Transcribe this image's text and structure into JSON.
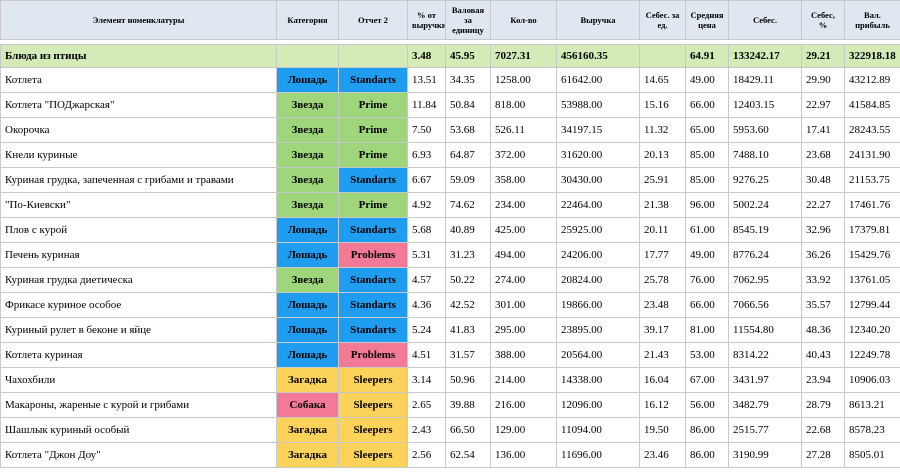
{
  "headers": {
    "name": "Элемент номенклатуры",
    "category": "Категория",
    "report2": "Отчет 2",
    "pct": "% от выручки",
    "gross_unit": "Валовая за единицу",
    "qty": "Кол-во",
    "revenue": "Выручка",
    "cost_unit": "Себес. за ед.",
    "avg_price": "Средняя цена",
    "cost": "Себес.",
    "cost_pct": "Себес, %",
    "gross_profit": "Вал. прибыль"
  },
  "total": {
    "name": "Блюда из птицы",
    "category": "",
    "report2": "",
    "pct": "3.48",
    "gross_unit": "45.95",
    "qty": "7027.31",
    "revenue": "456160.35",
    "cost_unit": "",
    "avg_price": "64.91",
    "cost": "133242.17",
    "cost_pct": "29.21",
    "gross_profit": "322918.18"
  },
  "rows": [
    {
      "name": "Котлета",
      "category": "Лошадь",
      "cat_class": "c-loshad",
      "report2": "Standarts",
      "rep_class": "r-standarts",
      "pct": "13.51",
      "gross_unit": "34.35",
      "qty": "1258.00",
      "revenue": "61642.00",
      "cost_unit": "14.65",
      "avg_price": "49.00",
      "cost": "18429.11",
      "cost_pct": "29.90",
      "gross_profit": "43212.89"
    },
    {
      "name": "Котлета \"ПОДжарская\"",
      "category": "Звезда",
      "cat_class": "c-zvezda",
      "report2": "Prime",
      "rep_class": "r-prime",
      "pct": "11.84",
      "gross_unit": "50.84",
      "qty": "818.00",
      "revenue": "53988.00",
      "cost_unit": "15.16",
      "avg_price": "66.00",
      "cost": "12403.15",
      "cost_pct": "22.97",
      "gross_profit": "41584.85"
    },
    {
      "name": "Окорочка",
      "category": "Звезда",
      "cat_class": "c-zvezda",
      "report2": "Prime",
      "rep_class": "r-prime",
      "pct": "7.50",
      "gross_unit": "53.68",
      "qty": "526.11",
      "revenue": "34197.15",
      "cost_unit": "11.32",
      "avg_price": "65.00",
      "cost": "5953.60",
      "cost_pct": "17.41",
      "gross_profit": "28243.55"
    },
    {
      "name": "Кнели куриные",
      "category": "Звезда",
      "cat_class": "c-zvezda",
      "report2": "Prime",
      "rep_class": "r-prime",
      "pct": "6.93",
      "gross_unit": "64.87",
      "qty": "372.00",
      "revenue": "31620.00",
      "cost_unit": "20.13",
      "avg_price": "85.00",
      "cost": "7488.10",
      "cost_pct": "23.68",
      "gross_profit": "24131.90"
    },
    {
      "name": "Куриная грудка, запеченная с грибами и травами",
      "category": "Звезда",
      "cat_class": "c-zvezda",
      "report2": "Standarts",
      "rep_class": "r-standarts",
      "pct": "6.67",
      "gross_unit": "59.09",
      "qty": "358.00",
      "revenue": "30430.00",
      "cost_unit": "25.91",
      "avg_price": "85.00",
      "cost": "9276.25",
      "cost_pct": "30.48",
      "gross_profit": "21153.75"
    },
    {
      "name": "\"По-Киевски\"",
      "category": "Звезда",
      "cat_class": "c-zvezda",
      "report2": "Prime",
      "rep_class": "r-prime",
      "pct": "4.92",
      "gross_unit": "74.62",
      "qty": "234.00",
      "revenue": "22464.00",
      "cost_unit": "21.38",
      "avg_price": "96.00",
      "cost": "5002.24",
      "cost_pct": "22.27",
      "gross_profit": "17461.76"
    },
    {
      "name": "Плов с курой",
      "category": "Лошадь",
      "cat_class": "c-loshad",
      "report2": "Standarts",
      "rep_class": "r-standarts",
      "pct": "5.68",
      "gross_unit": "40.89",
      "qty": "425.00",
      "revenue": "25925.00",
      "cost_unit": "20.11",
      "avg_price": "61.00",
      "cost": "8545.19",
      "cost_pct": "32.96",
      "gross_profit": "17379.81"
    },
    {
      "name": "Печень куриная",
      "category": "Лошадь",
      "cat_class": "c-loshad",
      "report2": "Problems",
      "rep_class": "r-problems",
      "pct": "5.31",
      "gross_unit": "31.23",
      "qty": "494.00",
      "revenue": "24206.00",
      "cost_unit": "17.77",
      "avg_price": "49.00",
      "cost": "8776.24",
      "cost_pct": "36.26",
      "gross_profit": "15429.76"
    },
    {
      "name": "Куриная грудка диетическа",
      "category": "Звезда",
      "cat_class": "c-zvezda",
      "report2": "Standarts",
      "rep_class": "r-standarts",
      "pct": "4.57",
      "gross_unit": "50.22",
      "qty": "274.00",
      "revenue": "20824.00",
      "cost_unit": "25.78",
      "avg_price": "76.00",
      "cost": "7062.95",
      "cost_pct": "33.92",
      "gross_profit": "13761.05"
    },
    {
      "name": "Фрикасе куриное особое",
      "category": "Лошадь",
      "cat_class": "c-loshad",
      "report2": "Standarts",
      "rep_class": "r-standarts",
      "pct": "4.36",
      "gross_unit": "42.52",
      "qty": "301.00",
      "revenue": "19866.00",
      "cost_unit": "23.48",
      "avg_price": "66.00",
      "cost": "7066.56",
      "cost_pct": "35.57",
      "gross_profit": "12799.44"
    },
    {
      "name": "Куриный рулет в беконе и яйце",
      "category": "Лошадь",
      "cat_class": "c-loshad",
      "report2": "Standarts",
      "rep_class": "r-standarts",
      "pct": "5.24",
      "gross_unit": "41.83",
      "qty": "295.00",
      "revenue": "23895.00",
      "cost_unit": "39.17",
      "avg_price": "81.00",
      "cost": "11554.80",
      "cost_pct": "48.36",
      "gross_profit": "12340.20"
    },
    {
      "name": "Котлета куриная",
      "category": "Лошадь",
      "cat_class": "c-loshad",
      "report2": "Problems",
      "rep_class": "r-problems",
      "pct": "4.51",
      "gross_unit": "31.57",
      "qty": "388.00",
      "revenue": "20564.00",
      "cost_unit": "21.43",
      "avg_price": "53.00",
      "cost": "8314.22",
      "cost_pct": "40.43",
      "gross_profit": "12249.78"
    },
    {
      "name": "Чахохбили",
      "category": "Загадка",
      "cat_class": "c-zagadka",
      "report2": "Sleepers",
      "rep_class": "r-sleepers",
      "pct": "3.14",
      "gross_unit": "50.96",
      "qty": "214.00",
      "revenue": "14338.00",
      "cost_unit": "16.04",
      "avg_price": "67.00",
      "cost": "3431.97",
      "cost_pct": "23.94",
      "gross_profit": "10906.03"
    },
    {
      "name": "Макароны, жареные с курой и грибами",
      "category": "Собака",
      "cat_class": "c-sobaka",
      "report2": "Sleepers",
      "rep_class": "r-sleepers",
      "pct": "2.65",
      "gross_unit": "39.88",
      "qty": "216.00",
      "revenue": "12096.00",
      "cost_unit": "16.12",
      "avg_price": "56.00",
      "cost": "3482.79",
      "cost_pct": "28.79",
      "gross_profit": "8613.21"
    },
    {
      "name": "Шашлык куриный особый",
      "category": "Загадка",
      "cat_class": "c-zagadka",
      "report2": "Sleepers",
      "rep_class": "r-sleepers",
      "pct": "2.43",
      "gross_unit": "66.50",
      "qty": "129.00",
      "revenue": "11094.00",
      "cost_unit": "19.50",
      "avg_price": "86.00",
      "cost": "2515.77",
      "cost_pct": "22.68",
      "gross_profit": "8578.23"
    },
    {
      "name": "Котлета \"Джон Доу\"",
      "category": "Загадка",
      "cat_class": "c-zagadka",
      "report2": "Sleepers",
      "rep_class": "r-sleepers",
      "pct": "2.56",
      "gross_unit": "62.54",
      "qty": "136.00",
      "revenue": "11696.00",
      "cost_unit": "23.46",
      "avg_price": "86.00",
      "cost": "3190.99",
      "cost_pct": "27.28",
      "gross_profit": "8505.01"
    }
  ]
}
